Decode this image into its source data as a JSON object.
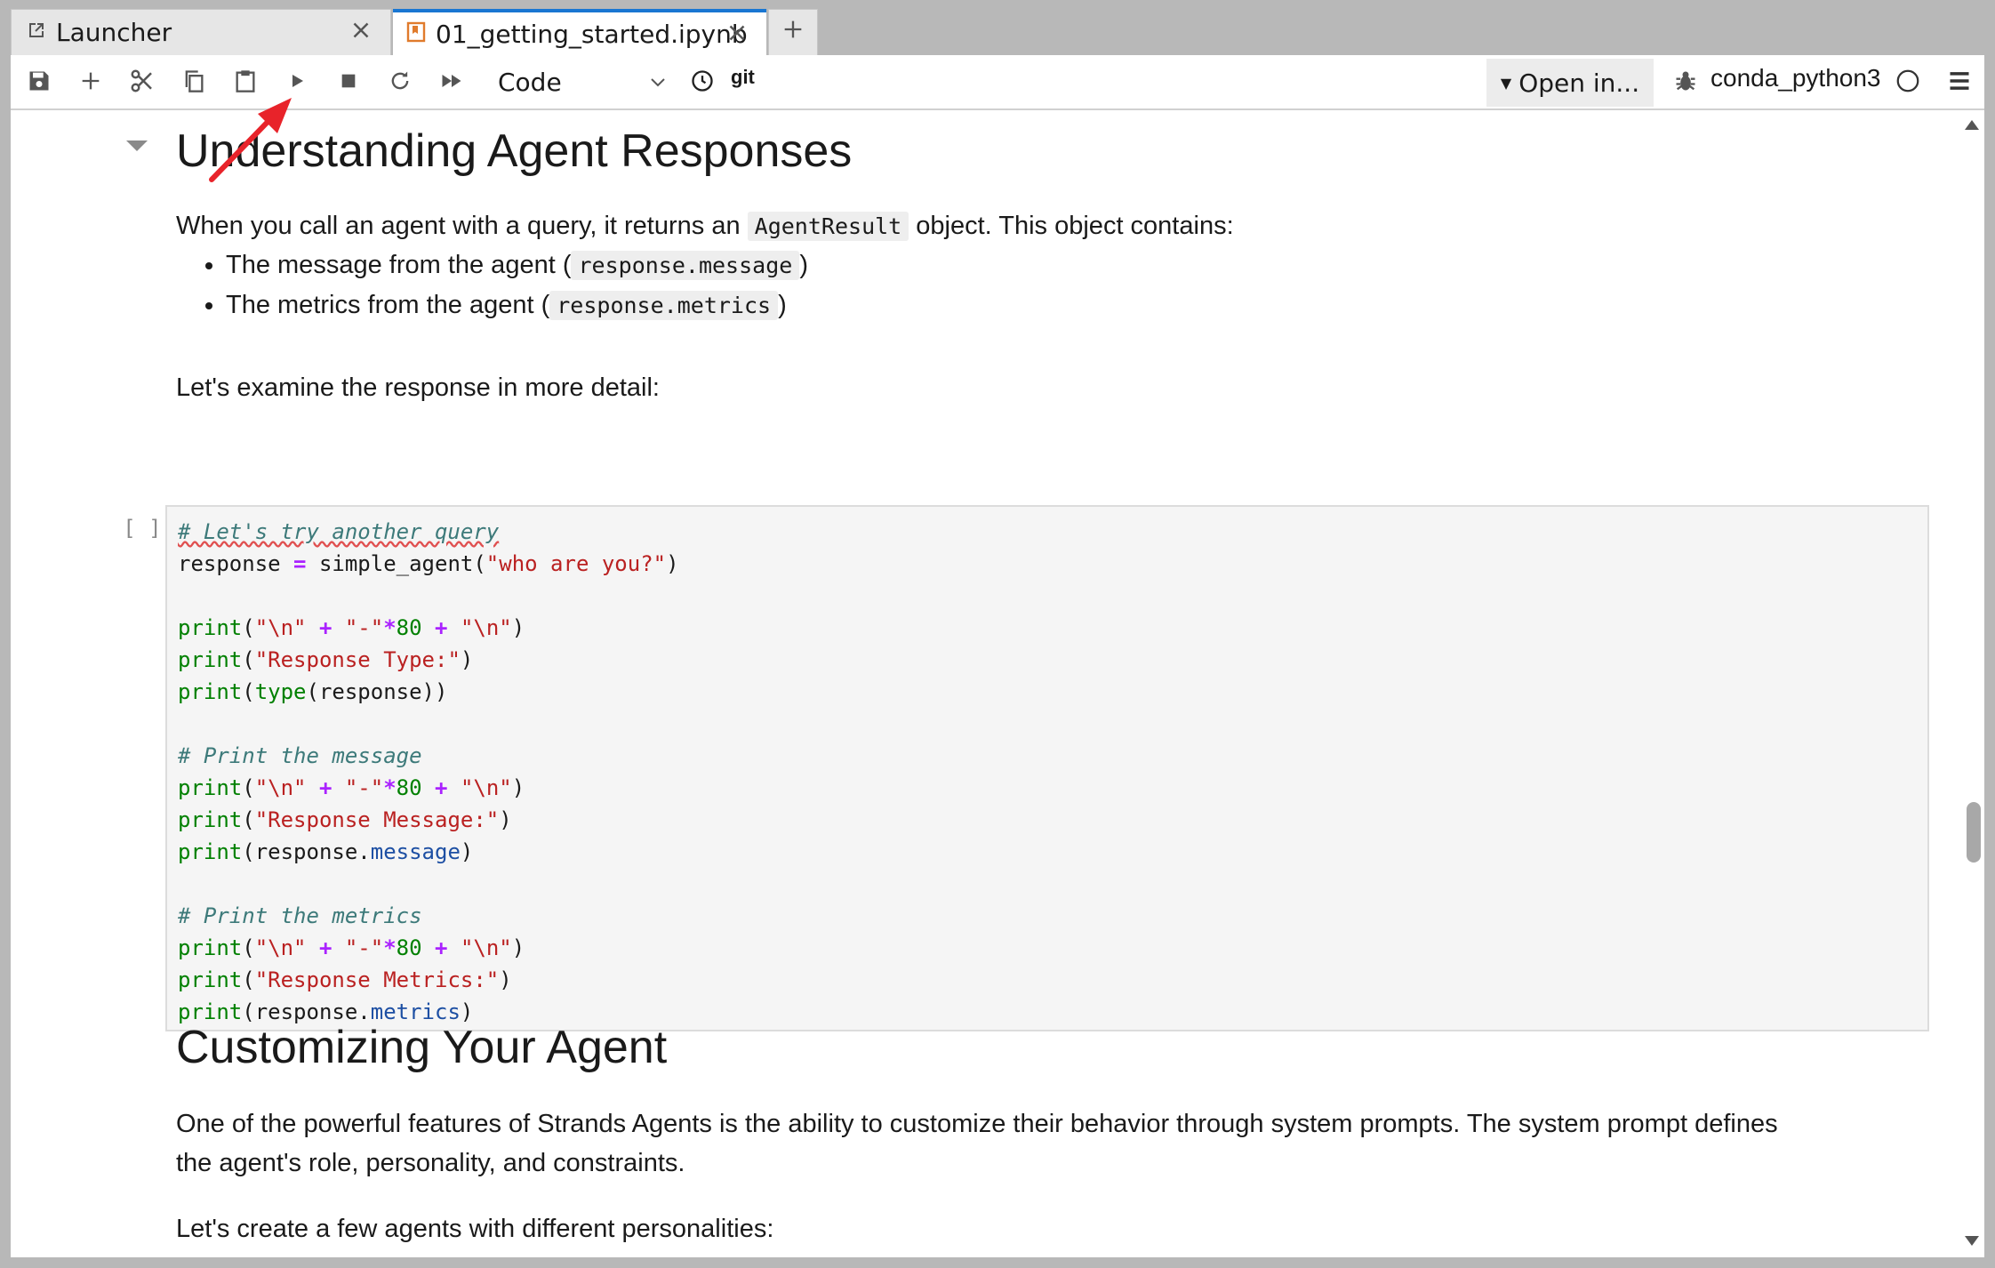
{
  "tabs": [
    {
      "label": "Launcher",
      "icon": "launcher-icon",
      "active": false
    },
    {
      "label": "01_getting_started.ipynb",
      "icon": "notebook-icon",
      "active": true
    }
  ],
  "toolbar": {
    "cell_type": "Code",
    "git_label": "git",
    "open_in_label": "Open in...",
    "kernel_name": "conda_python3"
  },
  "notebook": {
    "heading1": "Understanding Agent Responses",
    "intro": {
      "before": "When you call an agent with a query, it returns an ",
      "code": "AgentResult",
      "after": " object. This object contains:"
    },
    "bullets": [
      {
        "before": "The message from the agent (",
        "code": "response.message",
        "after": ")"
      },
      {
        "before": "The metrics from the agent (",
        "code": "response.metrics",
        "after": ")"
      }
    ],
    "examine_text": "Let's examine the response in more detail:",
    "prompt": "[ ]:",
    "code_lines": [
      "# Let's try another query",
      "response = simple_agent(\"who are you?\")",
      "",
      "print(\"\\n\" + \"-\"*80 + \"\\n\")",
      "print(\"Response Type:\")",
      "print(type(response))",
      "",
      "# Print the message",
      "print(\"\\n\" + \"-\"*80 + \"\\n\")",
      "print(\"Response Message:\")",
      "print(response.message)",
      "",
      "# Print the metrics",
      "print(\"\\n\" + \"-\"*80 + \"\\n\")",
      "print(\"Response Metrics:\")",
      "print(response.metrics)"
    ],
    "heading2": "Customizing Your Agent",
    "custom_line1": "One of the powerful features of Strands Agents is the ability to customize their behavior through system prompts. The system prompt defines",
    "custom_line2": "the agent's role, personality, and constraints.",
    "create_text": "Let's create a few agents with different personalities:"
  },
  "colors": {
    "active_tab_accent": "#1976d2",
    "notebook_icon": "#e07b2c",
    "annotation_arrow": "#e8232a",
    "code_background": "#f5f5f5"
  }
}
